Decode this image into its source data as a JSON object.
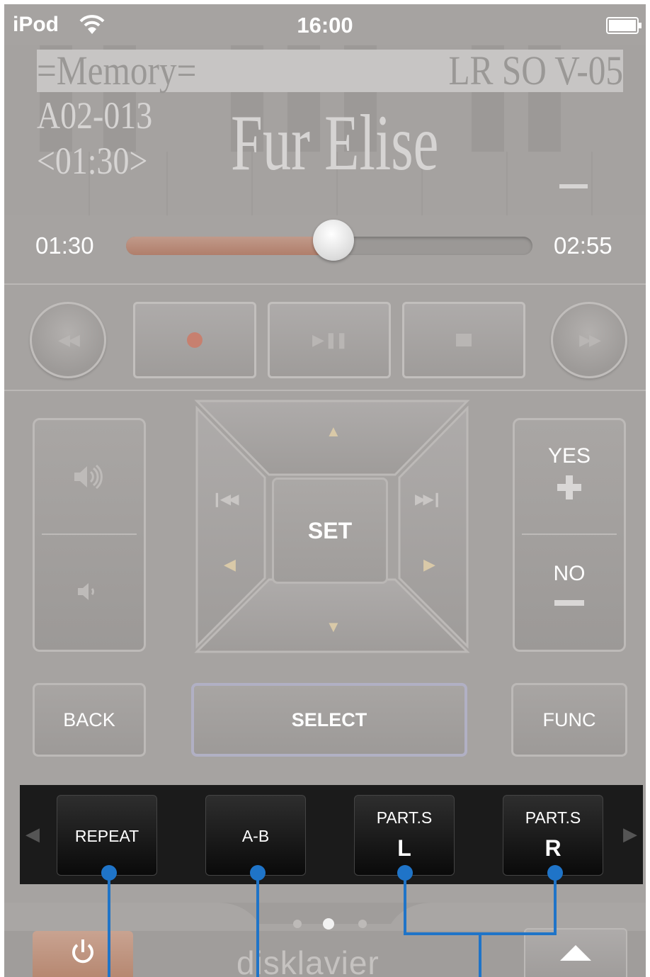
{
  "status_bar": {
    "carrier": "iPod",
    "time": "16:00"
  },
  "lcd": {
    "mode": "=Memory=",
    "status": "LR SO V-05",
    "song_number": "A02-013",
    "elapsed_display": "<01:30>",
    "song_title": "Fur Elise"
  },
  "progress": {
    "elapsed": "01:30",
    "total": "02:55",
    "fraction": 0.51
  },
  "transport": {
    "rewind_icon": "rewind-icon",
    "record_icon": "record-icon",
    "play_pause_icon": "play-pause-icon",
    "stop_icon": "stop-icon",
    "fast_forward_icon": "fast-forward-icon"
  },
  "volume": {
    "up_icon": "volume-up-icon",
    "down_icon": "volume-down-icon"
  },
  "dpad": {
    "set_label": "SET"
  },
  "confirm": {
    "yes_label": "YES",
    "no_label": "NO"
  },
  "buttons": {
    "back": "BACK",
    "select": "SELECT",
    "func": "FUNC"
  },
  "function_strip": {
    "repeat": "REPEAT",
    "ab": "A-B",
    "part_l_label": "PART.S",
    "part_l_letter": "L",
    "part_r_label": "PART.S",
    "part_r_letter": "R"
  },
  "page_indicator": {
    "pages": 3,
    "active": 2
  },
  "footer": {
    "brand": "disklavier"
  },
  "colors": {
    "accent": "#2f7fd0",
    "power": "#c09580",
    "progress_fill": "#b98a77"
  }
}
